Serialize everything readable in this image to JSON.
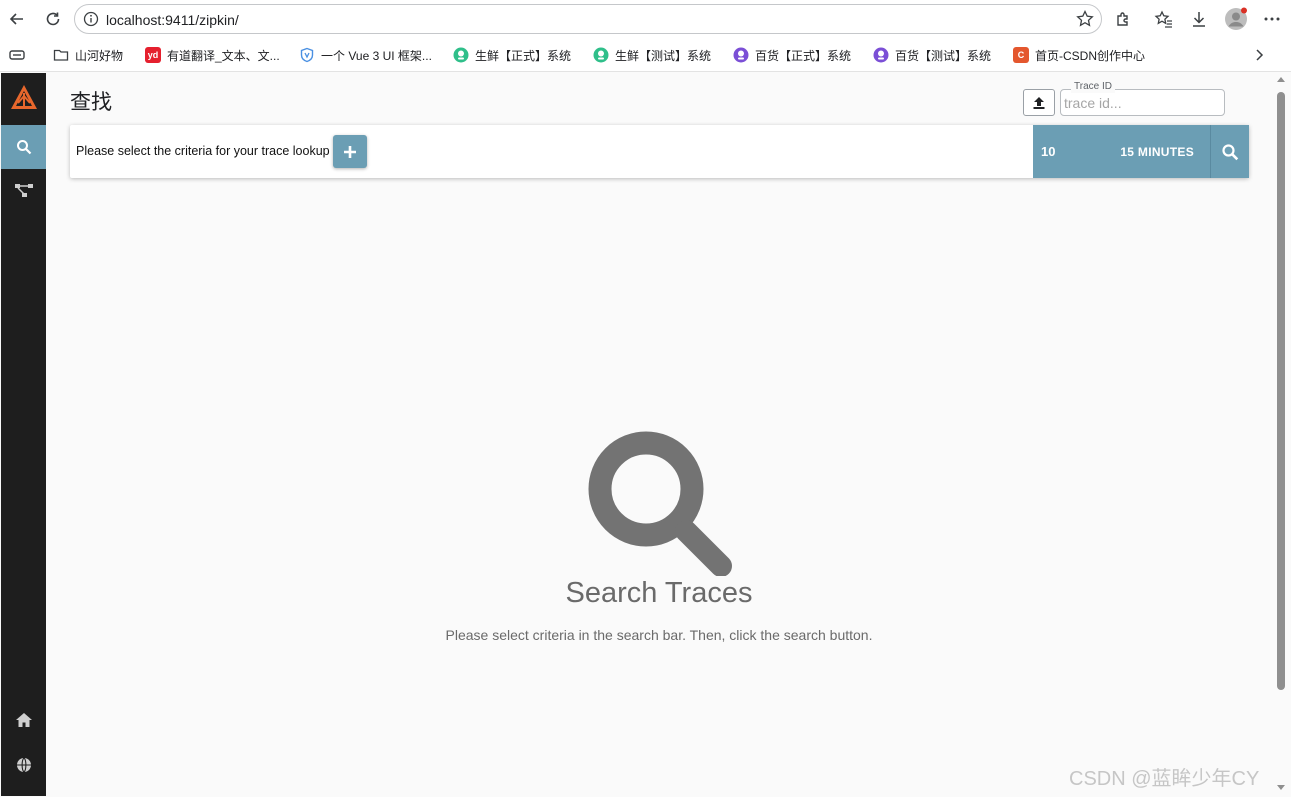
{
  "browser": {
    "url": "localhost:9411/zipkin/",
    "bookmarks": [
      {
        "label": "山河好物",
        "icon": "folder-icon",
        "color": "#5f6368"
      },
      {
        "label": "有道翻译_文本、文...",
        "icon": "youdao-icon",
        "color": "#e5202e"
      },
      {
        "label": "一个 Vue 3 UI 框架...",
        "icon": "vue-shield-icon",
        "color": "#4a90e2"
      },
      {
        "label": "生鲜【正式】系统",
        "icon": "app-icon",
        "color": "#2fbf8a"
      },
      {
        "label": "生鲜【测试】系统",
        "icon": "app-icon",
        "color": "#2fbf8a"
      },
      {
        "label": "百货【正式】系统",
        "icon": "app-icon",
        "color": "#7b4fd6"
      },
      {
        "label": "百货【测试】系统",
        "icon": "app-icon",
        "color": "#7b4fd6"
      },
      {
        "label": "首页-CSDN创作中心",
        "icon": "csdn-icon",
        "color": "#e4572e"
      }
    ]
  },
  "app": {
    "page_title": "查找",
    "trace_id": {
      "label": "Trace ID",
      "placeholder": "trace id..."
    },
    "search_bar": {
      "criteria_text": "Please select the criteria for your trace lookup",
      "limit": "10",
      "lookback": "15 MINUTES"
    },
    "empty_state": {
      "title": "Search Traces",
      "description": "Please select criteria in the search bar. Then, click the search button."
    },
    "colors": {
      "accent": "#6b9eb4",
      "sidebar": "#1e1e1e",
      "logo": "#e8672c"
    }
  },
  "watermark": "CSDN @蓝眸少年CY"
}
